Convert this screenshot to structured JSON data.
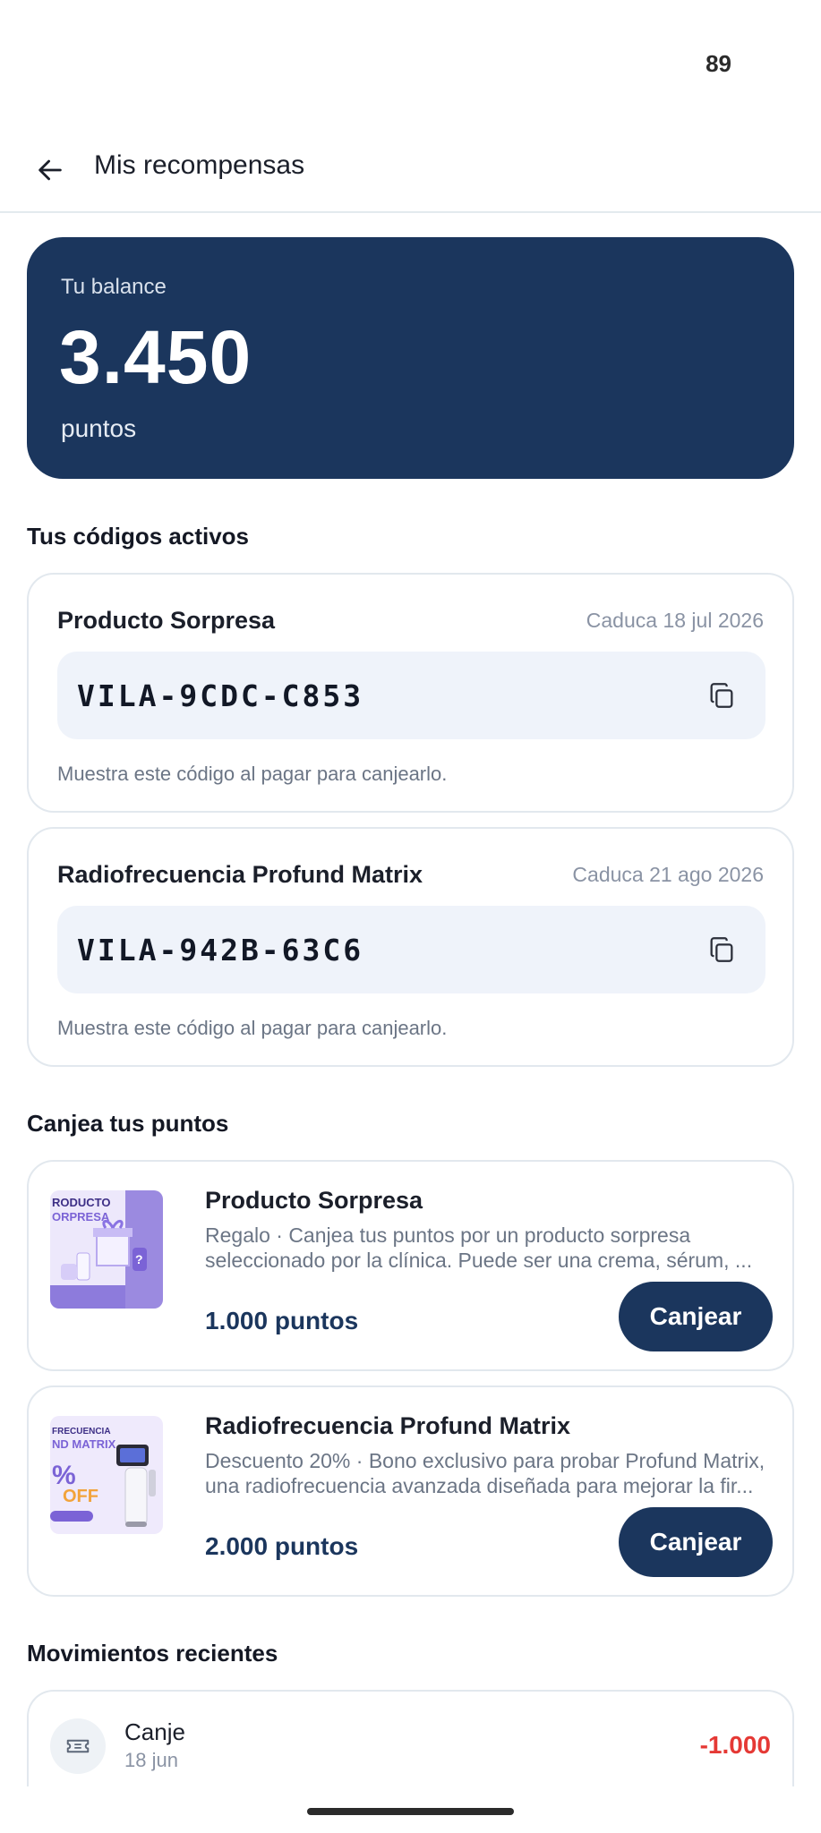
{
  "status_bar": {
    "number": "89"
  },
  "header": {
    "title": "Mis recompensas"
  },
  "balance": {
    "label": "Tu balance",
    "value": "3.450",
    "unit": "puntos"
  },
  "active_codes": {
    "title": "Tus códigos activos",
    "items": [
      {
        "name": "Producto Sorpresa",
        "expiry": "Caduca 18 jul 2026",
        "code": "VILA-9CDC-C853",
        "hint": "Muestra este código al pagar para canjearlo."
      },
      {
        "name": "Radiofrecuencia Profund Matrix",
        "expiry": "Caduca 21 ago 2026",
        "code": "VILA-942B-63C6",
        "hint": "Muestra este código al pagar para canjearlo."
      }
    ]
  },
  "redeem": {
    "title": "Canjea tus puntos",
    "items": [
      {
        "name": "Producto Sorpresa",
        "desc_line1": "Regalo · Canjea tus puntos por un producto sorpresa",
        "desc_line2": "seleccionado por la clínica. Puede ser una crema, sérum, ...",
        "points": "1.000 puntos",
        "button": "Canjear",
        "thumb_text1": "RODUCTO",
        "thumb_text2": "ORPRESA"
      },
      {
        "name": "Radiofrecuencia Profund Matrix",
        "desc_line1": "Descuento 20% · Bono exclusivo para probar Profund Matrix,",
        "desc_line2": "una radiofrecuencia avanzada diseñada para mejorar la fir...",
        "points": "2.000 puntos",
        "button": "Canjear",
        "thumb_text1": "FRECUENCIA",
        "thumb_text2": "ND MATRIX",
        "thumb_text3": "%",
        "thumb_text4": "OFF"
      }
    ]
  },
  "movements": {
    "title": "Movimientos recientes",
    "items": [
      {
        "label": "Canje",
        "date": "18 jun",
        "amount": "-1.000",
        "icon": "ticket-icon"
      }
    ]
  },
  "colors": {
    "brand": "#1b365d",
    "negative": "#e53935",
    "code_bg": "#eff3fa"
  }
}
